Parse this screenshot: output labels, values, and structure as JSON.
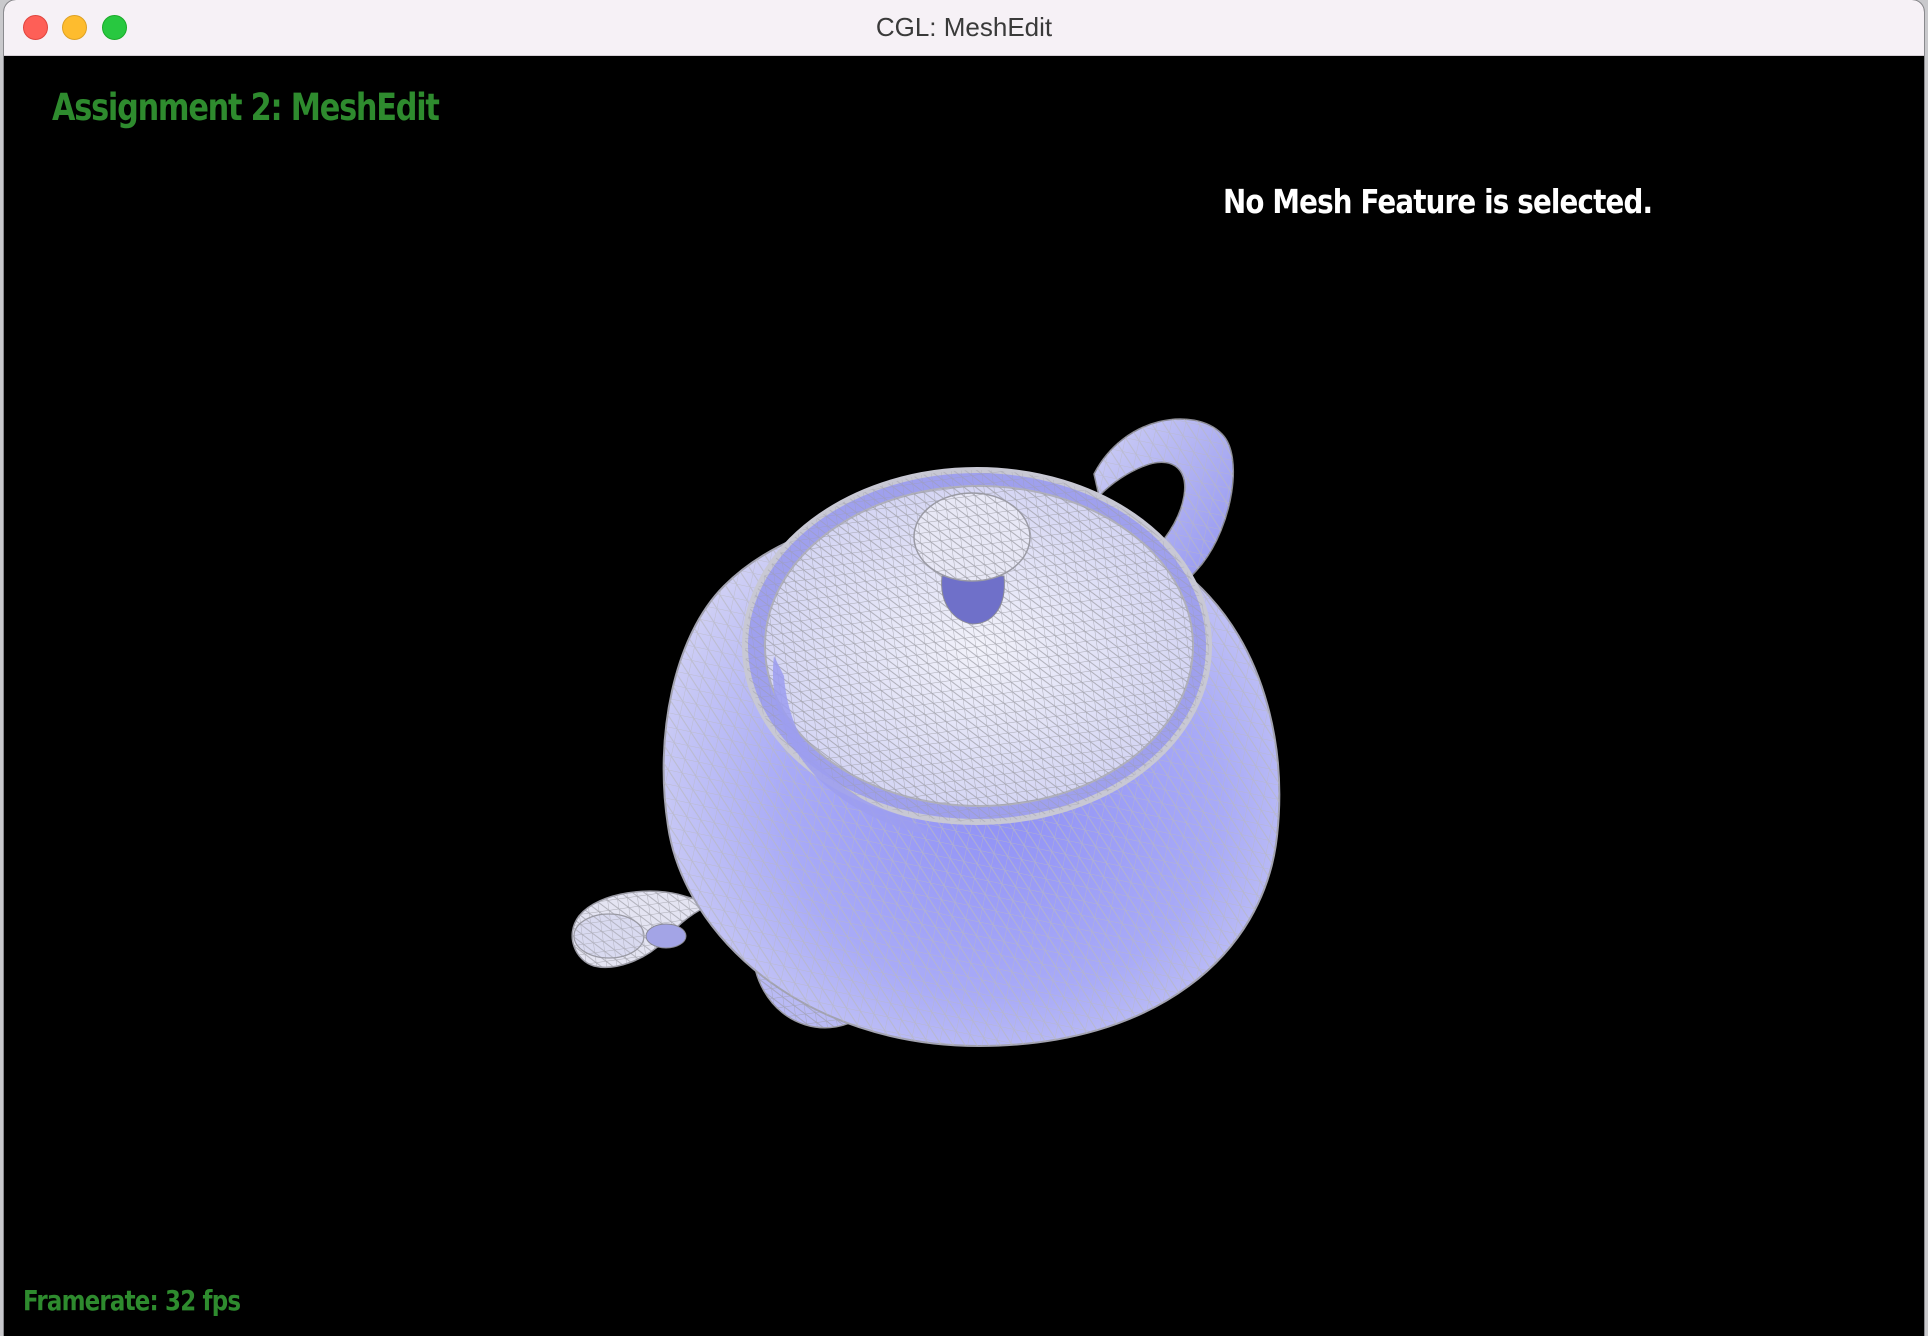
{
  "window": {
    "title": "CGL: MeshEdit"
  },
  "viewport": {
    "assignment_title": "Assignment 2: MeshEdit",
    "selection_status": "No Mesh Feature is selected.",
    "framerate": "Framerate: 32 fps",
    "object": "teapot-mesh"
  },
  "colors": {
    "background": "#000000",
    "title_green": "#2e8b2e",
    "mesh_fill": "#9a9cf5",
    "mesh_wire": "#9a9a9a",
    "text_white": "#ffffff"
  }
}
